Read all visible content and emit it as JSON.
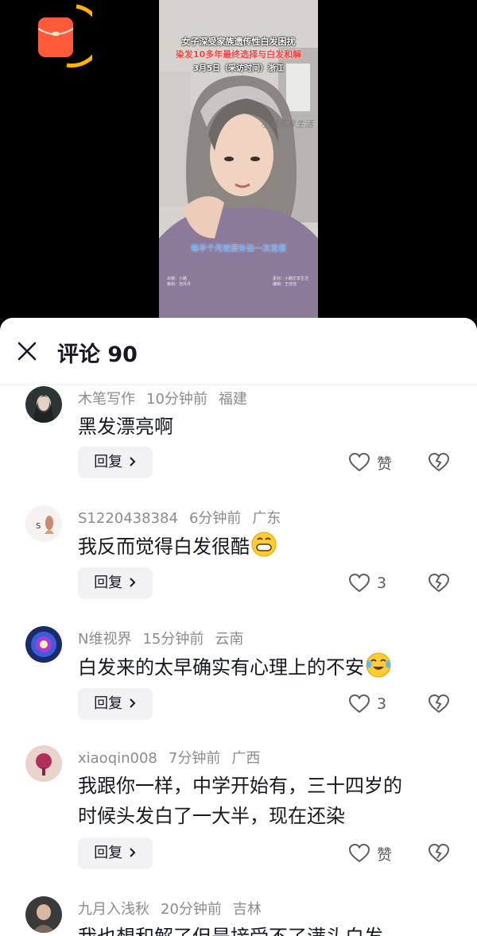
{
  "video": {
    "caption_line1": "女子深受家族遗传性白发困扰",
    "caption_line2": "染发10多年最终选择与白发和解",
    "caption_line3": "3月5日（采访时间）浙江",
    "watermark": "小路乐享生活",
    "subtitle": "每半个月就要补染一次发根",
    "credit_left": "出镜：小路\n策划：范月月",
    "credit_right": "素材：小路乐享生活\n编辑：王佳佳"
  },
  "comments_panel": {
    "title": "评论 90",
    "reply_label": "回复",
    "comments": [
      {
        "user": "木笔写作",
        "time": "10分钟前",
        "location": "福建",
        "text": "黑发漂亮啊",
        "likes": "赞"
      },
      {
        "user": "S1220438384",
        "time": "6分钟前",
        "location": "广东",
        "text": "我反而觉得白发很酷",
        "likes": "3"
      },
      {
        "user": "N维视界",
        "time": "15分钟前",
        "location": "云南",
        "text": "白发来的太早确实有心理上的不安",
        "likes": "3"
      },
      {
        "user": "xiaoqin008",
        "time": "7分钟前",
        "location": "广西",
        "text_line1": "我跟你一样，中学开始有，三十四岁的",
        "text_line2": "时候头发白了一大半，现在还染",
        "likes": "赞"
      },
      {
        "user": "九月入浅秋",
        "time": "20分钟前",
        "location": "吉林",
        "text": "我也想和解了但是接受不了满头白发"
      }
    ]
  },
  "colors": {
    "accent_red": "#fe2c55",
    "packet_orange": "#ff5a3a",
    "ring_yellow": "#ffb400",
    "meta_gray": "#8a8b91",
    "text_dark": "#161823"
  }
}
